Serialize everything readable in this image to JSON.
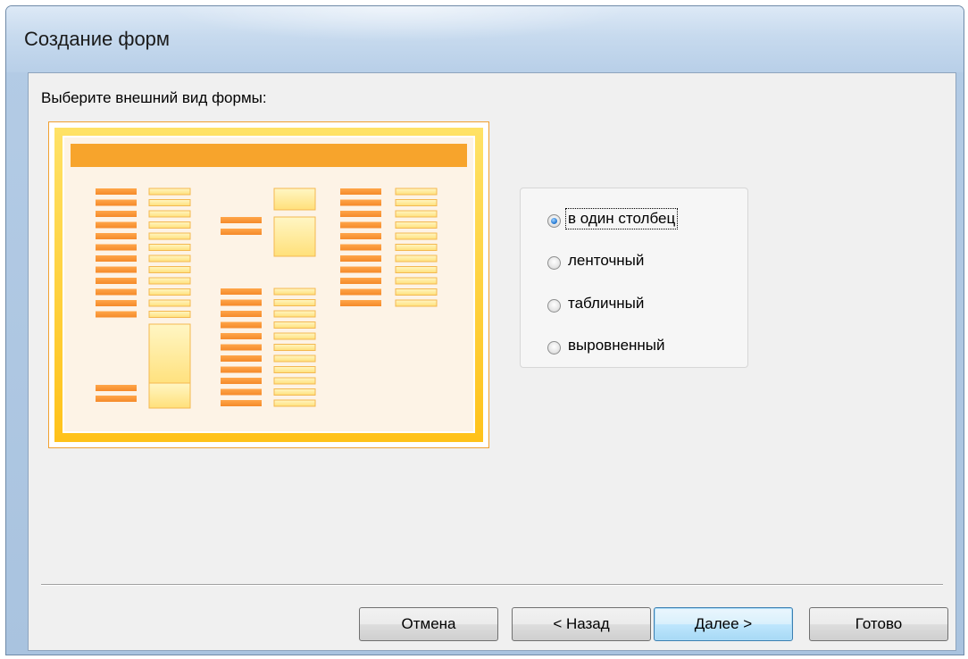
{
  "window": {
    "title": "Создание форм"
  },
  "wizard": {
    "prompt": "Выберите внешний вид формы:",
    "preview_icon": "form-layout-preview-icon",
    "options": [
      {
        "label": "в один столбец",
        "checked": true
      },
      {
        "label": "ленточный",
        "checked": false
      },
      {
        "label": "табличный",
        "checked": false
      },
      {
        "label": "выровненный",
        "checked": false
      }
    ]
  },
  "buttons": {
    "cancel": "Отмена",
    "back": "< Назад",
    "next": "Далее >",
    "finish": "Готово"
  },
  "colors": {
    "preview_orange": "#f7a42c",
    "preview_yellow": "#ffd234",
    "preview_bg": "#fdf3e6",
    "radio_selected": "#2d7fd6"
  }
}
